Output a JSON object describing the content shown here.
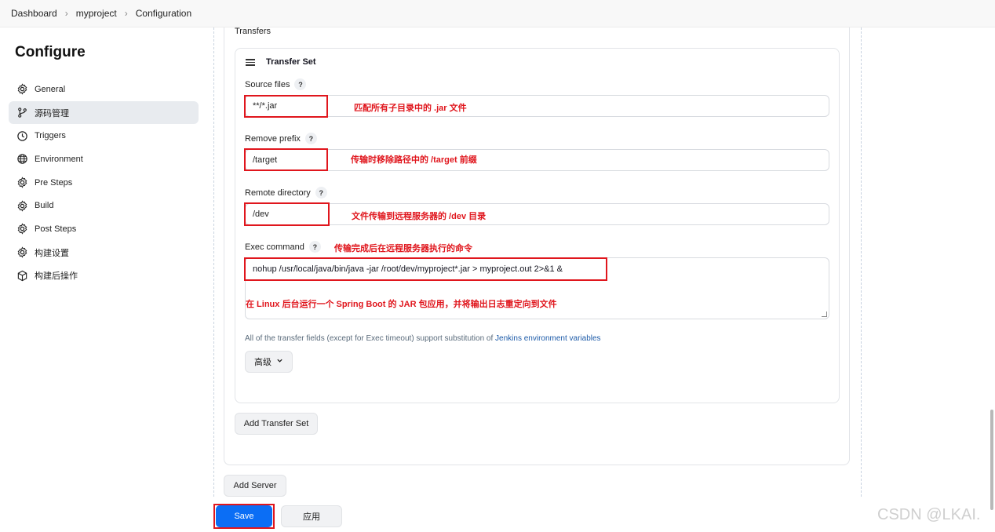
{
  "breadcrumb": {
    "items": [
      "Dashboard",
      "myproject",
      "Configuration"
    ]
  },
  "sidebar": {
    "title": "Configure",
    "items": [
      {
        "label": "General",
        "icon": "gear-icon"
      },
      {
        "label": "源码管理",
        "icon": "branch-icon",
        "active": true
      },
      {
        "label": "Triggers",
        "icon": "clock-icon"
      },
      {
        "label": "Environment",
        "icon": "globe-icon"
      },
      {
        "label": "Pre Steps",
        "icon": "gear-icon"
      },
      {
        "label": "Build",
        "icon": "gear-icon"
      },
      {
        "label": "Post Steps",
        "icon": "gear-icon"
      },
      {
        "label": "构建设置",
        "icon": "gear-icon"
      },
      {
        "label": "构建后操作",
        "icon": "cube-icon"
      }
    ]
  },
  "main": {
    "transfers_label": "Transfers",
    "transfer_set_title": "Transfer Set",
    "help_mark": "?",
    "source_files": {
      "label": "Source files",
      "value": "**/*.jar",
      "annotation": "匹配所有子目录中的 .jar 文件"
    },
    "remove_prefix": {
      "label": "Remove prefix",
      "value": "/target",
      "annotation": "传输时移除路径中的 /target 前缀"
    },
    "remote_directory": {
      "label": "Remote directory",
      "value": "/dev",
      "annotation": "文件传输到远程服务器的 /dev 目录"
    },
    "exec_command": {
      "label": "Exec command",
      "annotation": "传输完成后在远程服务器执行的命令",
      "value": "nohup /usr/local/java/bin/java -jar /root/dev/myproject*.jar > myproject.out 2>&1 &",
      "note": "在 Linux 后台运行一个 Spring Boot 的 JAR 包应用，并将输出日志重定向到文件"
    },
    "hint_text": "All of the transfer fields (except for Exec timeout) support substitution of ",
    "hint_link": "Jenkins environment variables",
    "advanced_label": "高级",
    "add_transfer_set_label": "Add Transfer Set",
    "add_server_label": "Add Server"
  },
  "footer": {
    "save_label": "Save",
    "apply_label": "应用"
  },
  "watermark": "CSDN @LKAI.",
  "colors": {
    "primary": "#0b6ef5",
    "annotation": "#e0161d",
    "link": "#1c5aa8"
  }
}
